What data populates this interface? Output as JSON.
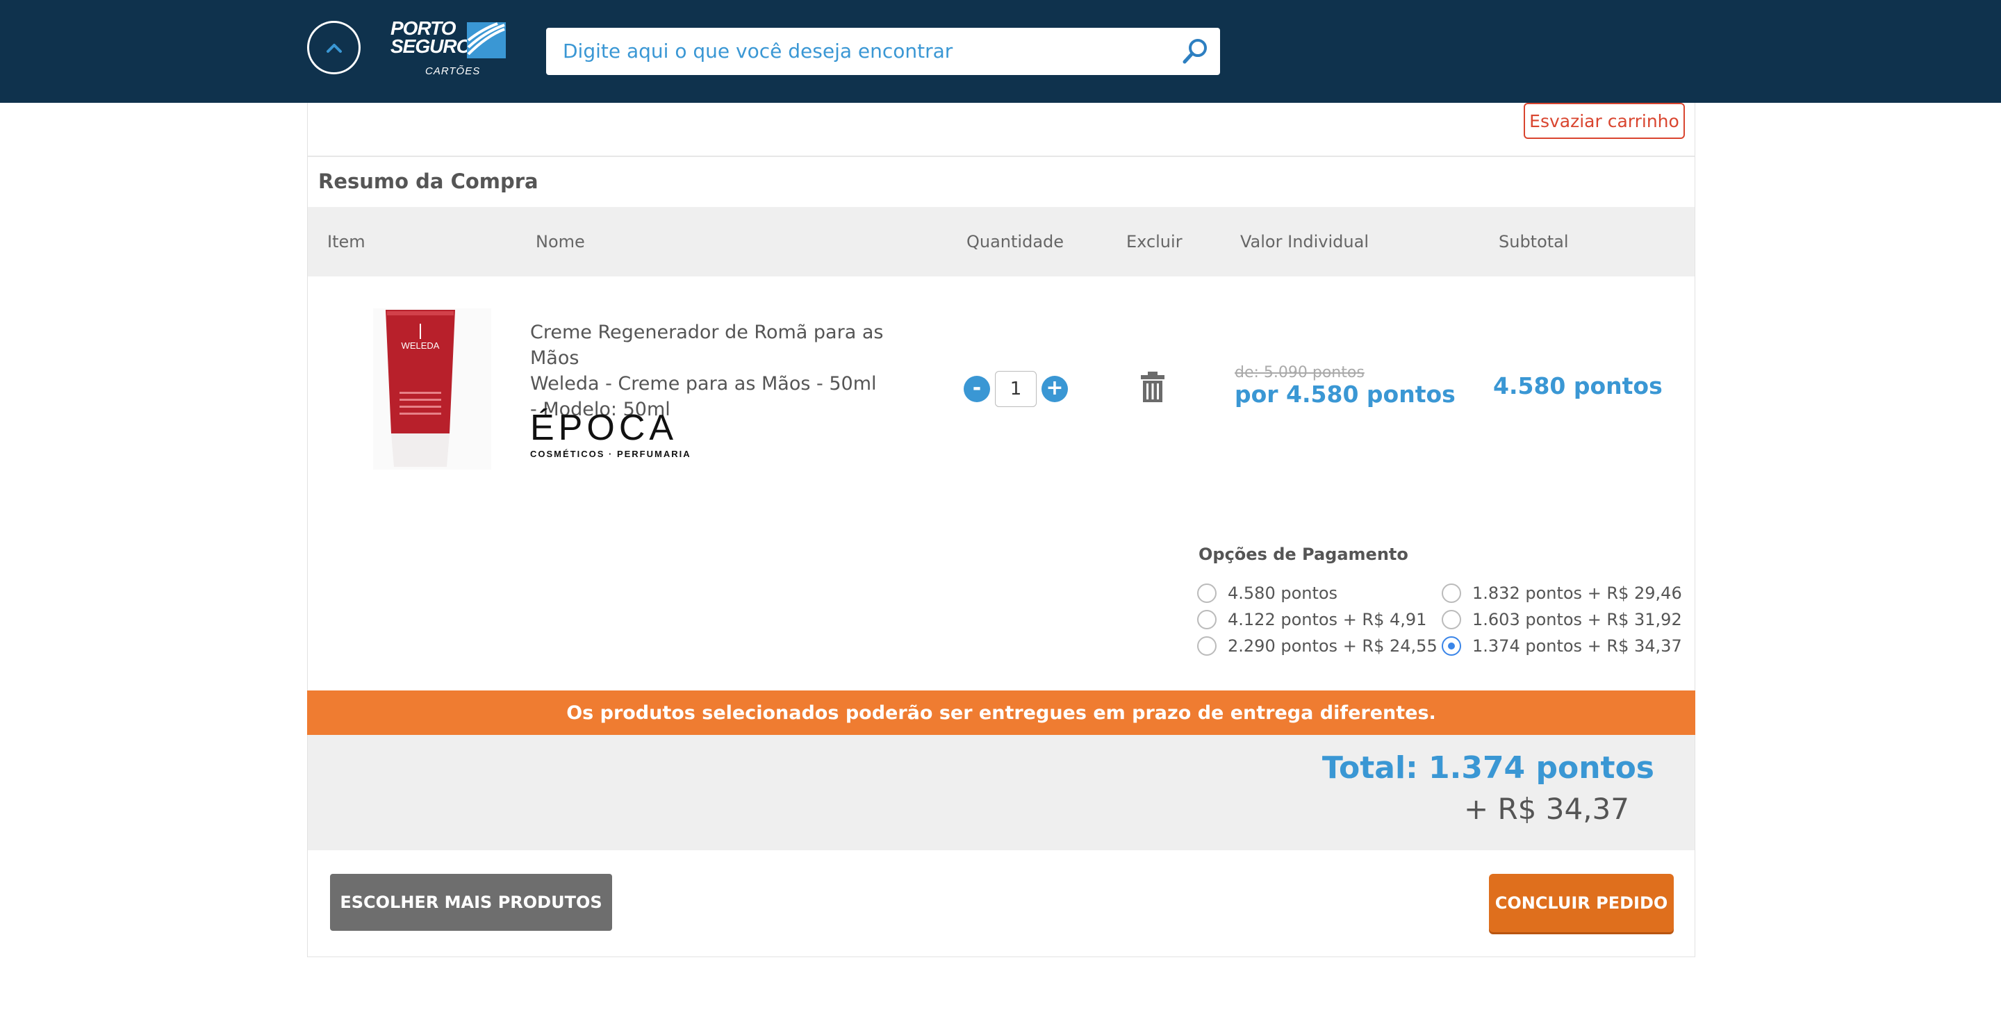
{
  "header": {
    "logo_line1": "PORTO",
    "logo_line2": "SEGURO",
    "logo_sub": "CARTÕES",
    "search_placeholder": "Digite aqui o que você deseja encontrar",
    "bg_color": "#0f324d",
    "accent": "#3a97d4"
  },
  "cart": {
    "empty_cart_label": "Esvaziar carrinho",
    "section_title": "Resumo da Compra",
    "columns": [
      "Item",
      "Nome",
      "Quantidade",
      "Excluir",
      "Valor Individual",
      "Subtotal"
    ],
    "item": {
      "name_lines": [
        "Creme Regenerador de Romã para as Mãos",
        "Weleda - Creme para as Mãos - 50ml",
        "- Modelo: 50ml"
      ],
      "image_label": "WELEDA",
      "brand_name": "ÉPOCA",
      "brand_sub": "COSMÉTICOS · PERFUMARIA",
      "quantity": "1",
      "minus": "-",
      "plus": "+",
      "old_price": "de: 5.090 pontos",
      "new_price": "por 4.580 pontos",
      "subtotal": "4.580 pontos"
    },
    "payment": {
      "title": "Opções de Pagamento",
      "options": [
        {
          "label": "4.580 pontos",
          "selected": false
        },
        {
          "label": "4.122 pontos + R$ 4,91",
          "selected": false
        },
        {
          "label": "2.290 pontos + R$ 24,55",
          "selected": false
        },
        {
          "label": "1.832 pontos + R$ 29,46",
          "selected": false
        },
        {
          "label": "1.603 pontos + R$ 31,92",
          "selected": false
        },
        {
          "label": "1.374 pontos + R$ 34,37",
          "selected": true
        }
      ]
    },
    "banner": "Os produtos selecionados poderão ser entregues em prazo de entrega diferentes.",
    "total_label": "Total: 1.374 pontos",
    "total_money": "+ R$ 34,37",
    "more_button": "ESCOLHER MAIS PRODUTOS",
    "finish_button": "CONCLUIR PEDIDO",
    "banner_color": "#ef7c31",
    "finish_color": "#df6f1d"
  }
}
